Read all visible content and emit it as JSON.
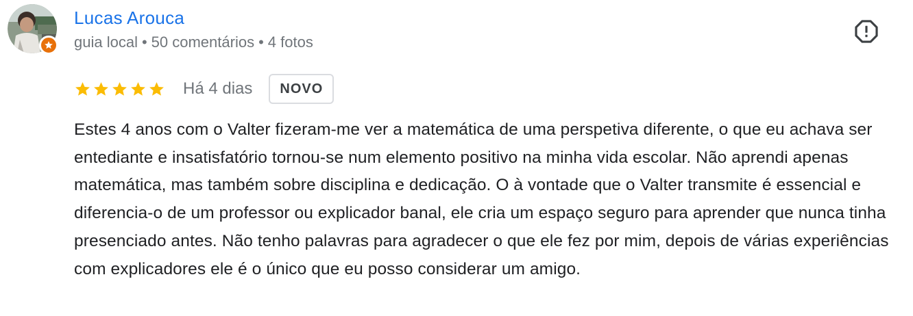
{
  "review": {
    "author": {
      "name": "Lucas Arouca",
      "role": "guia local",
      "reviews_count": "50 comentários",
      "photos_count": "4 fotos",
      "separator": "•",
      "avatar_icon": "user-photo",
      "badge_icon": "local-guide-star-icon"
    },
    "rating": {
      "stars": 5,
      "max": 5,
      "star_color": "#fbbc04"
    },
    "date": "Há 4 dias",
    "badge": "NOVO",
    "flag_icon": "report-flag-icon",
    "text": "Estes 4 anos com o Valter fizeram-me ver a matemática de uma perspetiva diferente, o que eu achava ser entediante e insatisfatório tornou-se num elemento positivo na minha vida escolar. Não aprendi apenas matemática, mas também sobre disciplina e dedicação. O à vontade que o Valter transmite é essencial e diferencia-o de um professor ou explicador banal, ele cria um espaço seguro para aprender que nunca tinha presenciado antes. Não tenho palavras para agradecer o que ele fez por mim, depois de várias experiências com explicadores ele é o único que eu posso considerar um amigo."
  },
  "colors": {
    "name_link": "#1a73e8",
    "meta_text": "#70757a",
    "body_text": "#202124",
    "badge_orange": "#e8710a"
  }
}
